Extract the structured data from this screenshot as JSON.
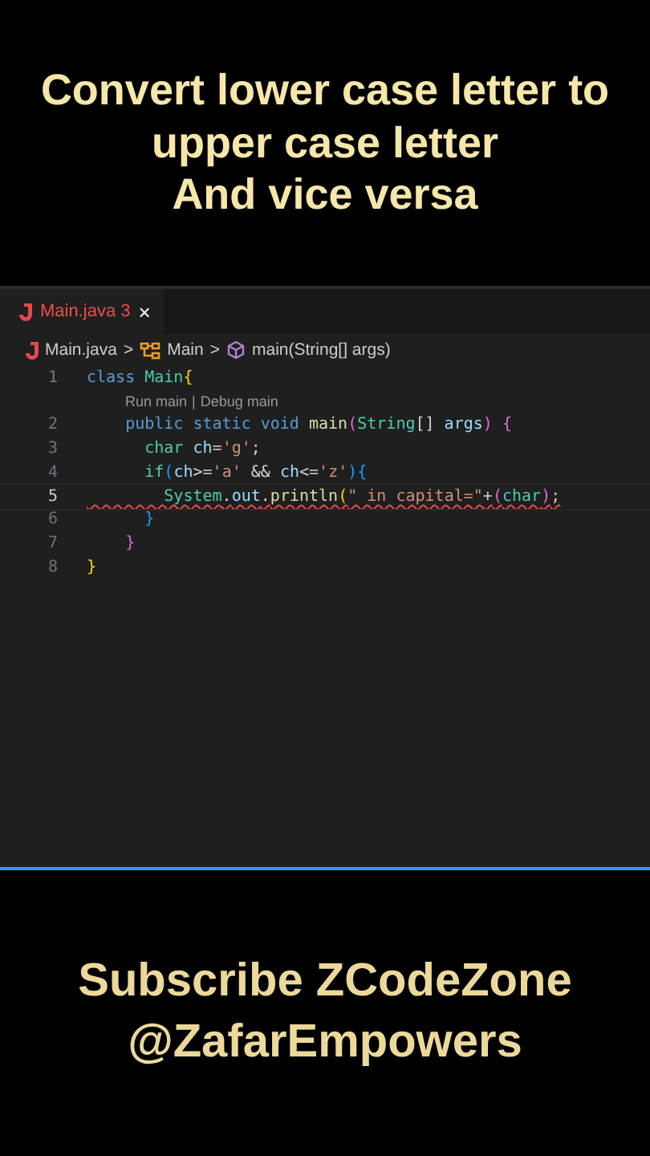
{
  "caption_top": [
    "Convert lower case letter to",
    "upper case letter",
    "And vice versa"
  ],
  "editor": {
    "tab": {
      "label": "Main.java 3",
      "close": "×",
      "has_errors": true
    },
    "breadcrumb": [
      {
        "kind": "file",
        "label": "Main.java"
      },
      {
        "kind": "class",
        "label": "Main"
      },
      {
        "kind": "method",
        "label": "main(String[] args)"
      }
    ],
    "breadcrumb_separator": ">",
    "lines": [
      {
        "number": "1",
        "active": false,
        "squiggle": false,
        "tokens": [
          {
            "kind": "keyword",
            "text": "class "
          },
          {
            "kind": "type",
            "text": "Main"
          },
          {
            "kind": "bracket1",
            "text": "{"
          }
        ]
      },
      {
        "kind": "codelens",
        "items": [
          "Run main",
          "Debug main"
        ],
        "separator": "|"
      },
      {
        "number": "2",
        "active": false,
        "squiggle": false,
        "tokens": [
          {
            "kind": "keyword",
            "text": "    public static void "
          },
          {
            "kind": "function",
            "text": "main"
          },
          {
            "kind": "bracket2",
            "text": "("
          },
          {
            "kind": "type",
            "text": "String"
          },
          {
            "kind": "plain",
            "text": "[] "
          },
          {
            "kind": "variable",
            "text": "args"
          },
          {
            "kind": "bracket2",
            "text": ")"
          },
          {
            "kind": "bracket2",
            "text": " {"
          }
        ]
      },
      {
        "number": "3",
        "active": false,
        "squiggle": false,
        "tokens": [
          {
            "kind": "type",
            "text": "      char "
          },
          {
            "kind": "variable",
            "text": "ch"
          },
          {
            "kind": "plain",
            "text": "="
          },
          {
            "kind": "string",
            "text": "'g'"
          },
          {
            "kind": "plain",
            "text": ";"
          }
        ]
      },
      {
        "number": "4",
        "active": false,
        "squiggle": false,
        "tokens": [
          {
            "kind": "type",
            "text": "      if"
          },
          {
            "kind": "bracket3",
            "text": "("
          },
          {
            "kind": "variable",
            "text": "ch"
          },
          {
            "kind": "plain",
            "text": ">="
          },
          {
            "kind": "string",
            "text": "'a'"
          },
          {
            "kind": "plain",
            "text": " && "
          },
          {
            "kind": "variable",
            "text": "ch"
          },
          {
            "kind": "plain",
            "text": "<="
          },
          {
            "kind": "string",
            "text": "'z'"
          },
          {
            "kind": "bracket3",
            "text": ")"
          },
          {
            "kind": "bracket3",
            "text": "{"
          }
        ]
      },
      {
        "number": "5",
        "active": true,
        "squiggle": true,
        "tokens": [
          {
            "kind": "type",
            "text": "        System"
          },
          {
            "kind": "plain",
            "text": "."
          },
          {
            "kind": "variable",
            "text": "out"
          },
          {
            "kind": "plain",
            "text": "."
          },
          {
            "kind": "function",
            "text": "println"
          },
          {
            "kind": "bracket1",
            "text": "("
          },
          {
            "kind": "string",
            "text": "\" in capital=\""
          },
          {
            "kind": "plain",
            "text": "+"
          },
          {
            "kind": "bracket2",
            "text": "("
          },
          {
            "kind": "type",
            "text": "char"
          },
          {
            "kind": "bracket2",
            "text": ")"
          },
          {
            "kind": "plain",
            "text": ";"
          }
        ]
      },
      {
        "number": "6",
        "active": false,
        "squiggle": false,
        "tokens": [
          {
            "kind": "bracket3",
            "text": "      }"
          }
        ]
      },
      {
        "number": "7",
        "active": false,
        "squiggle": false,
        "tokens": [
          {
            "kind": "bracket2",
            "text": "    }"
          }
        ]
      },
      {
        "number": "8",
        "active": false,
        "squiggle": false,
        "tokens": [
          {
            "kind": "bracket1",
            "text": "}"
          }
        ]
      }
    ]
  },
  "caption_bottom": [
    "Subscribe ZCodeZone",
    "@ZafarEmpowers"
  ]
}
